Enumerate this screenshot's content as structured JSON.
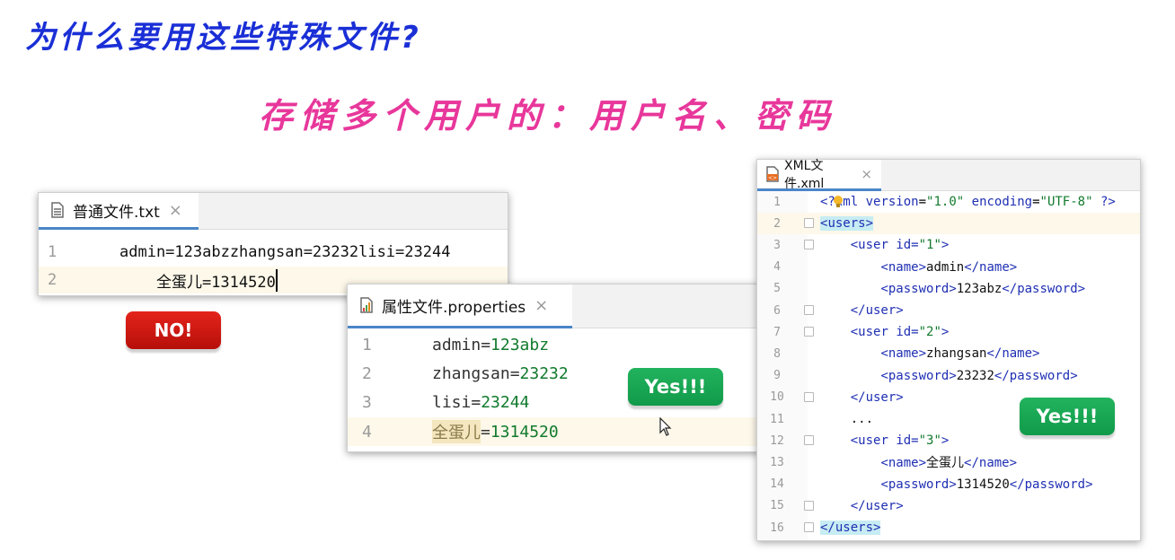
{
  "title": "为什么要用这些特殊文件?",
  "subtitle": "存储多个用户的：用户名、密码",
  "txt_window": {
    "tab_label": "普通文件.txt",
    "close_glyph": "×",
    "lines": [
      {
        "num": "1",
        "text": "admin=123abzzhangsan=23232lisi=23244"
      },
      {
        "num": "2",
        "text": "    全蛋儿=1314520"
      }
    ]
  },
  "no_button": "NO!",
  "props_window": {
    "tab_label": "属性文件.properties",
    "close_glyph": "×",
    "lines": [
      {
        "num": "1",
        "key": "admin",
        "eq": "=",
        "value": "123abz"
      },
      {
        "num": "2",
        "key": "zhangsan",
        "eq": "=",
        "value": "23232"
      },
      {
        "num": "3",
        "key": "lisi",
        "eq": "=",
        "value": "23244"
      },
      {
        "num": "4",
        "key": "全蛋儿",
        "eq": "=",
        "value": "1314520"
      }
    ]
  },
  "yes_button_1": "Yes!!!",
  "yes_button_2": "Yes!!!",
  "xml_window": {
    "tab_label": "XML文件.xml",
    "close_glyph": "×",
    "lines": [
      {
        "num": "1"
      },
      {
        "num": "2"
      },
      {
        "num": "3"
      },
      {
        "num": "4"
      },
      {
        "num": "5"
      },
      {
        "num": "6"
      },
      {
        "num": "7"
      },
      {
        "num": "8"
      },
      {
        "num": "9"
      },
      {
        "num": "10"
      },
      {
        "num": "11"
      },
      {
        "num": "12"
      },
      {
        "num": "13"
      },
      {
        "num": "14"
      },
      {
        "num": "15"
      },
      {
        "num": "16"
      }
    ],
    "decl": {
      "open": "<?",
      "name": "xml",
      "version_attr": "version",
      "version_val": "\"1.0\"",
      "enc_attr": "encoding",
      "enc_val": "\"UTF-8\"",
      "close": "?>"
    },
    "users_tag": "users",
    "user_tag": "user",
    "id_attr": "id",
    "name_tag": "name",
    "password_tag": "password",
    "ellipsis": "...",
    "users": [
      {
        "id": "\"1\"",
        "name": "admin",
        "password": "123abz"
      },
      {
        "id": "\"2\"",
        "name": "zhangsan",
        "password": "23232"
      },
      {
        "id": "\"3\"",
        "name": "全蛋儿",
        "password": "1314520"
      }
    ]
  },
  "colors": {
    "title": "#1a2fd6",
    "subtitle": "#e8379b",
    "no_button": "#d41a12",
    "yes_button": "#17a653",
    "tab_underline": "#4a86c8"
  }
}
